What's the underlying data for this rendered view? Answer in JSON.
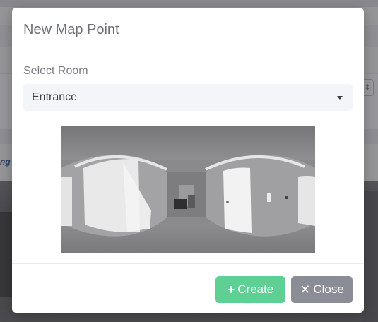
{
  "modal": {
    "title": "New Map Point",
    "select_label": "Select Room",
    "selected_room": "Entrance",
    "preview_image": "room-panorama",
    "buttons": {
      "create_icon": "+",
      "create_label": "Create",
      "close_icon": "✕",
      "close_label": "Close"
    }
  },
  "background": {
    "partial_link_text": "ng"
  },
  "colors": {
    "create_button": "#5fd093",
    "close_button": "#8a8c96",
    "select_bg": "#f3f5f9",
    "title_text": "#6c6f78"
  }
}
